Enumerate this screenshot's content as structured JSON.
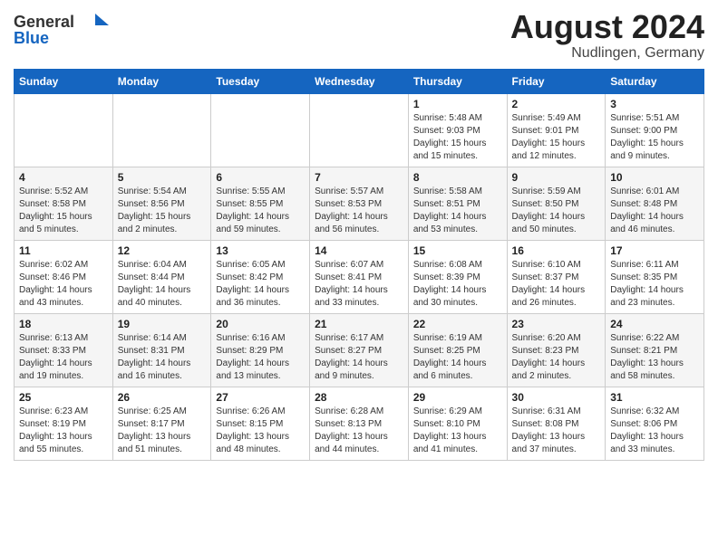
{
  "header": {
    "logo_general": "General",
    "logo_blue": "Blue",
    "month_year": "August 2024",
    "location": "Nudlingen, Germany"
  },
  "weekdays": [
    "Sunday",
    "Monday",
    "Tuesday",
    "Wednesday",
    "Thursday",
    "Friday",
    "Saturday"
  ],
  "weeks": [
    [
      {
        "day": "",
        "info": ""
      },
      {
        "day": "",
        "info": ""
      },
      {
        "day": "",
        "info": ""
      },
      {
        "day": "",
        "info": ""
      },
      {
        "day": "1",
        "info": "Sunrise: 5:48 AM\nSunset: 9:03 PM\nDaylight: 15 hours\nand 15 minutes."
      },
      {
        "day": "2",
        "info": "Sunrise: 5:49 AM\nSunset: 9:01 PM\nDaylight: 15 hours\nand 12 minutes."
      },
      {
        "day": "3",
        "info": "Sunrise: 5:51 AM\nSunset: 9:00 PM\nDaylight: 15 hours\nand 9 minutes."
      }
    ],
    [
      {
        "day": "4",
        "info": "Sunrise: 5:52 AM\nSunset: 8:58 PM\nDaylight: 15 hours\nand 5 minutes."
      },
      {
        "day": "5",
        "info": "Sunrise: 5:54 AM\nSunset: 8:56 PM\nDaylight: 15 hours\nand 2 minutes."
      },
      {
        "day": "6",
        "info": "Sunrise: 5:55 AM\nSunset: 8:55 PM\nDaylight: 14 hours\nand 59 minutes."
      },
      {
        "day": "7",
        "info": "Sunrise: 5:57 AM\nSunset: 8:53 PM\nDaylight: 14 hours\nand 56 minutes."
      },
      {
        "day": "8",
        "info": "Sunrise: 5:58 AM\nSunset: 8:51 PM\nDaylight: 14 hours\nand 53 minutes."
      },
      {
        "day": "9",
        "info": "Sunrise: 5:59 AM\nSunset: 8:50 PM\nDaylight: 14 hours\nand 50 minutes."
      },
      {
        "day": "10",
        "info": "Sunrise: 6:01 AM\nSunset: 8:48 PM\nDaylight: 14 hours\nand 46 minutes."
      }
    ],
    [
      {
        "day": "11",
        "info": "Sunrise: 6:02 AM\nSunset: 8:46 PM\nDaylight: 14 hours\nand 43 minutes."
      },
      {
        "day": "12",
        "info": "Sunrise: 6:04 AM\nSunset: 8:44 PM\nDaylight: 14 hours\nand 40 minutes."
      },
      {
        "day": "13",
        "info": "Sunrise: 6:05 AM\nSunset: 8:42 PM\nDaylight: 14 hours\nand 36 minutes."
      },
      {
        "day": "14",
        "info": "Sunrise: 6:07 AM\nSunset: 8:41 PM\nDaylight: 14 hours\nand 33 minutes."
      },
      {
        "day": "15",
        "info": "Sunrise: 6:08 AM\nSunset: 8:39 PM\nDaylight: 14 hours\nand 30 minutes."
      },
      {
        "day": "16",
        "info": "Sunrise: 6:10 AM\nSunset: 8:37 PM\nDaylight: 14 hours\nand 26 minutes."
      },
      {
        "day": "17",
        "info": "Sunrise: 6:11 AM\nSunset: 8:35 PM\nDaylight: 14 hours\nand 23 minutes."
      }
    ],
    [
      {
        "day": "18",
        "info": "Sunrise: 6:13 AM\nSunset: 8:33 PM\nDaylight: 14 hours\nand 19 minutes."
      },
      {
        "day": "19",
        "info": "Sunrise: 6:14 AM\nSunset: 8:31 PM\nDaylight: 14 hours\nand 16 minutes."
      },
      {
        "day": "20",
        "info": "Sunrise: 6:16 AM\nSunset: 8:29 PM\nDaylight: 14 hours\nand 13 minutes."
      },
      {
        "day": "21",
        "info": "Sunrise: 6:17 AM\nSunset: 8:27 PM\nDaylight: 14 hours\nand 9 minutes."
      },
      {
        "day": "22",
        "info": "Sunrise: 6:19 AM\nSunset: 8:25 PM\nDaylight: 14 hours\nand 6 minutes."
      },
      {
        "day": "23",
        "info": "Sunrise: 6:20 AM\nSunset: 8:23 PM\nDaylight: 14 hours\nand 2 minutes."
      },
      {
        "day": "24",
        "info": "Sunrise: 6:22 AM\nSunset: 8:21 PM\nDaylight: 13 hours\nand 58 minutes."
      }
    ],
    [
      {
        "day": "25",
        "info": "Sunrise: 6:23 AM\nSunset: 8:19 PM\nDaylight: 13 hours\nand 55 minutes."
      },
      {
        "day": "26",
        "info": "Sunrise: 6:25 AM\nSunset: 8:17 PM\nDaylight: 13 hours\nand 51 minutes."
      },
      {
        "day": "27",
        "info": "Sunrise: 6:26 AM\nSunset: 8:15 PM\nDaylight: 13 hours\nand 48 minutes."
      },
      {
        "day": "28",
        "info": "Sunrise: 6:28 AM\nSunset: 8:13 PM\nDaylight: 13 hours\nand 44 minutes."
      },
      {
        "day": "29",
        "info": "Sunrise: 6:29 AM\nSunset: 8:10 PM\nDaylight: 13 hours\nand 41 minutes."
      },
      {
        "day": "30",
        "info": "Sunrise: 6:31 AM\nSunset: 8:08 PM\nDaylight: 13 hours\nand 37 minutes."
      },
      {
        "day": "31",
        "info": "Sunrise: 6:32 AM\nSunset: 8:06 PM\nDaylight: 13 hours\nand 33 minutes."
      }
    ]
  ]
}
